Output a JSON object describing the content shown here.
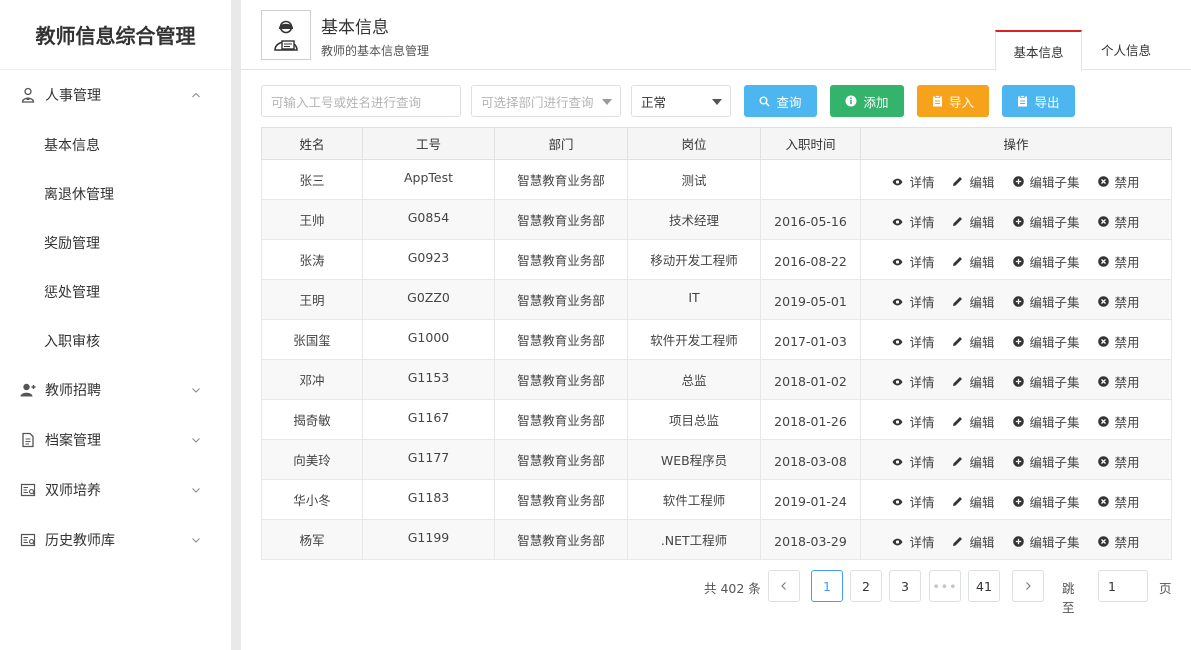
{
  "sidebar": {
    "brand": "教师信息综合管理",
    "groups": [
      {
        "label": "人事管理",
        "icon": "person-badge-icon",
        "expanded": true,
        "items": [
          "基本信息",
          "离退休管理",
          "奖励管理",
          "惩处管理",
          "入职审核"
        ]
      },
      {
        "label": "教师招聘",
        "icon": "user-add-icon",
        "expanded": false
      },
      {
        "label": "档案管理",
        "icon": "document-icon",
        "expanded": false
      },
      {
        "label": "双师培养",
        "icon": "id-card-icon",
        "expanded": false
      },
      {
        "label": "历史教师库",
        "icon": "id-card-icon",
        "expanded": false
      }
    ]
  },
  "header": {
    "title": "基本信息",
    "subtitle": "教师的基本信息管理",
    "icon": "teacher-icon",
    "tabs": [
      {
        "label": "基本信息",
        "active": true
      },
      {
        "label": "个人信息",
        "active": false
      }
    ]
  },
  "filters": {
    "search_placeholder": "可输入工号或姓名进行查询",
    "dept_placeholder": "可选择部门进行查询",
    "status_value": "正常",
    "buttons": {
      "query": "查询",
      "add": "添加",
      "import": "导入",
      "export": "导出"
    },
    "colors": {
      "query": "#4db6f0",
      "add": "#33b36b",
      "import": "#f7a21b",
      "export": "#4db6f0"
    }
  },
  "table": {
    "columns": [
      "姓名",
      "工号",
      "部门",
      "岗位",
      "入职时间",
      "操作"
    ],
    "actions": [
      "详情",
      "编辑",
      "编辑子集",
      "禁用"
    ],
    "rows": [
      {
        "name": "张三",
        "id": "AppTest",
        "dept": "智慧教育业务部",
        "post": "测试",
        "date": ""
      },
      {
        "name": "王帅",
        "id": "G0854",
        "dept": "智慧教育业务部",
        "post": "技术经理",
        "date": "2016-05-16"
      },
      {
        "name": "张涛",
        "id": "G0923",
        "dept": "智慧教育业务部",
        "post": "移动开发工程师",
        "date": "2016-08-22"
      },
      {
        "name": "王明",
        "id": "G0ZZ0",
        "dept": "智慧教育业务部",
        "post": "IT",
        "date": "2019-05-01"
      },
      {
        "name": "张国玺",
        "id": "G1000",
        "dept": "智慧教育业务部",
        "post": "软件开发工程师",
        "date": "2017-01-03"
      },
      {
        "name": "邓冲",
        "id": "G1153",
        "dept": "智慧教育业务部",
        "post": "总监",
        "date": "2018-01-02"
      },
      {
        "name": "揭奇敏",
        "id": "G1167",
        "dept": "智慧教育业务部",
        "post": "项目总监",
        "date": "2018-01-26"
      },
      {
        "name": "向美玲",
        "id": "G1177",
        "dept": "智慧教育业务部",
        "post": "WEB程序员",
        "date": "2018-03-08"
      },
      {
        "name": "华小冬",
        "id": "G1183",
        "dept": "智慧教育业务部",
        "post": "软件工程师",
        "date": "2019-01-24"
      },
      {
        "name": "杨军",
        "id": "G1199",
        "dept": "智慧教育业务部",
        "post": ".NET工程师",
        "date": "2018-03-29"
      }
    ]
  },
  "pagination": {
    "total_text": "共 402 条",
    "pages": [
      "1",
      "2",
      "3",
      "•••",
      "41"
    ],
    "current": "1",
    "jump_label": "跳至",
    "jump_value": "1",
    "page_suffix": "页"
  }
}
